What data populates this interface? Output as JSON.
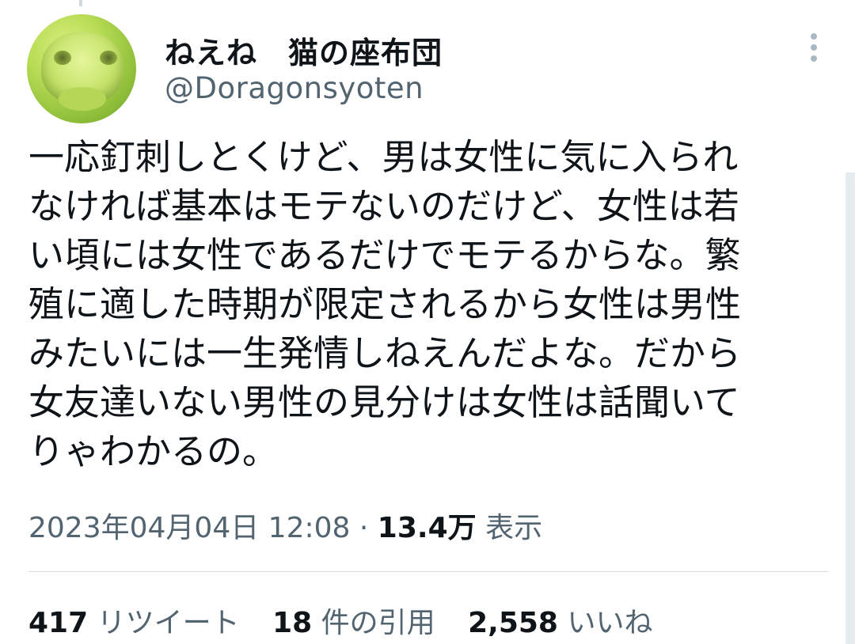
{
  "author": {
    "display_name": "ねえね　猫の座布団",
    "handle": "@Doragonsyoten",
    "avatar_icon": "frog-avatar"
  },
  "menu": {
    "icon": "more-vertical-icon"
  },
  "tweet": {
    "lines": [
      "一応釘刺しとくけど、男は女性に気に入られ",
      "なければ基本はモテないのだけど、女性は若",
      "い頃には女性であるだけでモテるからな。繁",
      "殖に適した時期が限定されるから女性は男性",
      "みたいには一生発情しねえんだよな。だから",
      "女友達いない男性の見分けは女性は話聞いて",
      "りゃわかるの。"
    ]
  },
  "meta": {
    "timestamp": "2023年04月04日 12:08",
    "separator": "·",
    "views_count": "13.4万",
    "views_label": "表示"
  },
  "stats": {
    "retweets_count": "417",
    "retweets_label": "リツイート",
    "quotes_count": "18",
    "quotes_label": "件の引用",
    "likes_count": "2,558",
    "likes_label": "いいね"
  },
  "colors": {
    "text_primary": "#0f1419",
    "text_secondary": "#536471",
    "divider": "#d6dde2"
  }
}
